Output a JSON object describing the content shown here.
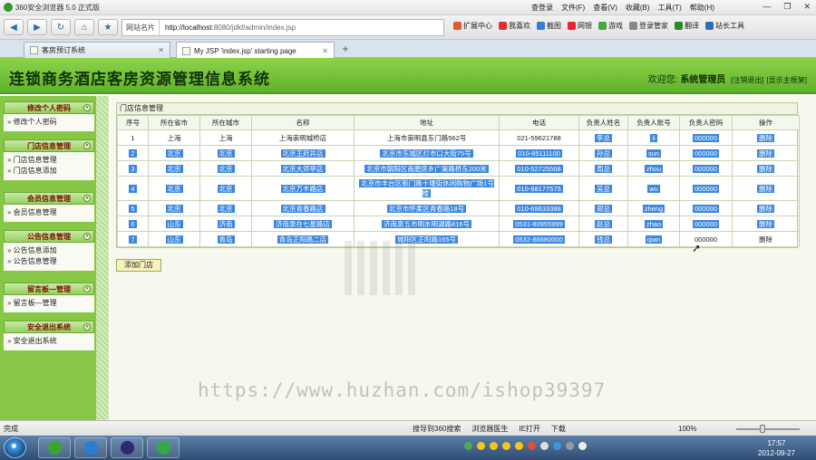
{
  "browser": {
    "title": "360安全浏览器 5.0 正式版",
    "menu": [
      "查登录",
      "文件(F)",
      "查看(V)",
      "收藏(B)",
      "工具(T)",
      "帮助(H)"
    ],
    "address_prefix": "网站名片",
    "url_host": "http://localhost",
    "url_rest": ":8080/jdkf/admin/index.jsp",
    "toolbar_items": [
      "扩展中心",
      "我喜欢",
      "截图",
      "网银",
      "游戏",
      "登录管家",
      "翻译",
      "站长工具"
    ],
    "tabs": [
      {
        "label": "客房预订系统",
        "active": false
      },
      {
        "label": "My JSP 'index.jsp' starting page",
        "active": true
      }
    ],
    "new_tab": "+"
  },
  "header": {
    "title": "连锁商务酒店客房资源管理信息系统",
    "welcome_prefix": "欢迎您:",
    "user": "系统管理员",
    "logout": "[注销退出]",
    "show_admin": "[显示主框架]"
  },
  "sidebar": {
    "groups": [
      {
        "title": "修改个人密码",
        "items": [
          "修改个人密码"
        ]
      },
      {
        "title": "门店信息管理",
        "items": [
          "门店信息管理",
          "门店信息添加"
        ]
      },
      {
        "title": "会员信息管理",
        "items": [
          "会员信息管理"
        ]
      },
      {
        "title": "公告信息管理",
        "items": [
          "公告信息添加",
          "公告信息管理"
        ]
      },
      {
        "title": "留言板—管理",
        "items": [
          "留言板—管理"
        ]
      },
      {
        "title": "安全退出系统",
        "items": [
          "安全退出系统"
        ]
      }
    ]
  },
  "panel": {
    "title": "门店信息管理",
    "columns": [
      "序号",
      "所在省市",
      "所在城市",
      "名称",
      "地址",
      "电话",
      "负责人姓名",
      "负责人账号",
      "负责人密码",
      "操作"
    ],
    "rows": [
      [
        "1",
        "上海",
        "上海",
        "上海崇明城桥店",
        "上海市崇明县东门路562号",
        "021-59621788",
        "李总",
        "li",
        "000000",
        "删除"
      ],
      [
        "2",
        "北京",
        "北京",
        "北京王府井店",
        "北京市东城区灯市口大街75号",
        "010-85111100",
        "孙总",
        "sun",
        "000000",
        "删除"
      ],
      [
        "3",
        "北京",
        "北京",
        "北京大郊亭店",
        "北京市朝阳区南磨房乡广渠路桥东200米",
        "010-52725568",
        "周总",
        "zhou",
        "000000",
        "删除"
      ],
      [
        "4",
        "北京",
        "北京",
        "北京万丰路店",
        "北京市丰台区新门路十堰街休闲购物广场1号楼",
        "010-88177575",
        "吴总",
        "wu",
        "000000",
        "删除"
      ],
      [
        "5",
        "北京",
        "北京",
        "北京青春路店",
        "北京市怀柔区青春路18号",
        "010-69633388",
        "郑总",
        "zheng",
        "000000",
        "删除"
      ],
      [
        "6",
        "山东",
        "济南",
        "济南泉在七星路店",
        "济南泉五市明水明湖路816号",
        "0531-80955999",
        "赵总",
        "zhao",
        "000000",
        "删除"
      ],
      [
        "7",
        "山东",
        "青岛",
        "青岛正阳路二店",
        "城阳区正阳路165号",
        "0532-86680000",
        "钱总",
        "qian",
        "000000",
        "删除"
      ]
    ],
    "add_button": "添加门店"
  },
  "watermark": "https://www.huzhan.com/ishop39397",
  "status": {
    "left": "完成",
    "items": [
      "搜导到360搜索",
      "浏览器医生",
      "IE打开",
      "下载"
    ],
    "zoom": "100%"
  },
  "taskbar": {
    "time": "17:57",
    "date": "2012-09-27"
  }
}
